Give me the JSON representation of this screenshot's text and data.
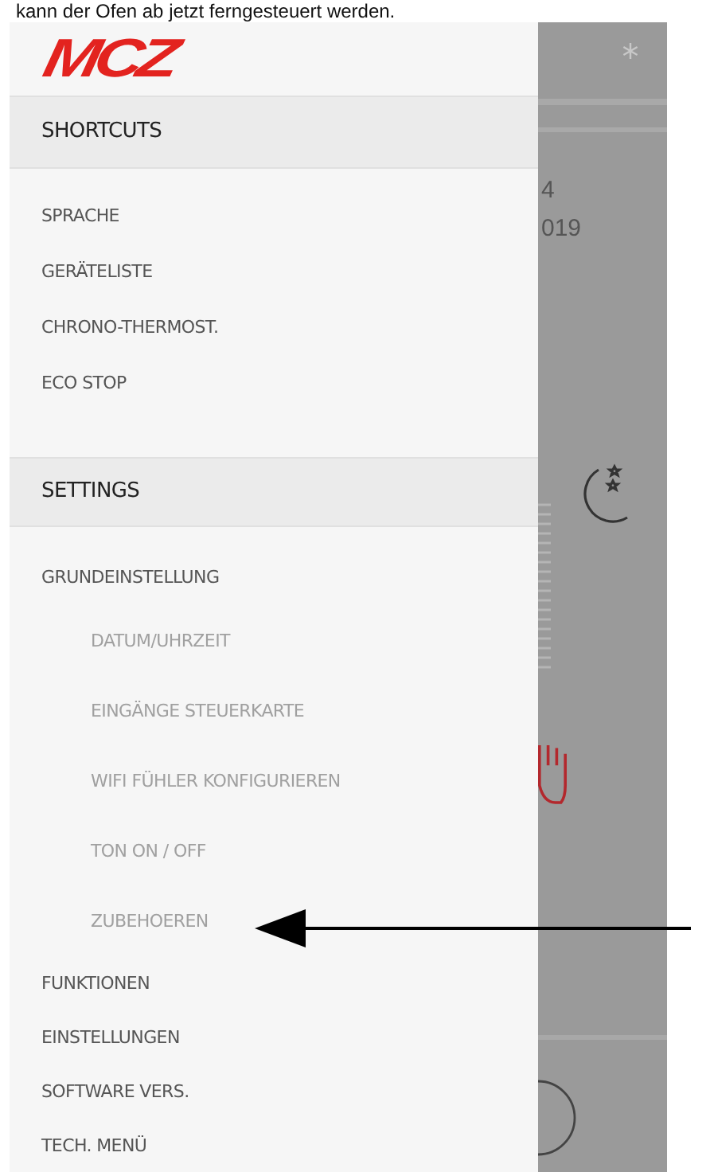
{
  "caption": "kann der Ofen ab jetzt ferngesteuert werden.",
  "logo": "MCZ",
  "shortcuts": {
    "header": "SHORTCUTS",
    "items": [
      {
        "label": "SPRACHE"
      },
      {
        "label": "GERÄTELISTE"
      },
      {
        "label": "CHRONO-THERMOST."
      },
      {
        "label": "ECO STOP"
      }
    ]
  },
  "settings": {
    "header": "SETTINGS",
    "items": [
      {
        "label": "GRUNDEINSTELLUNG",
        "children": [
          {
            "label": "DATUM/UHRZEIT"
          },
          {
            "label": "EINGÄNGE STEUERKARTE"
          },
          {
            "label": "WIFI FÜHLER KONFIGURIEREN"
          },
          {
            "label": "TON ON / OFF"
          },
          {
            "label": "ZUBEHOEREN"
          }
        ]
      },
      {
        "label": "FUNKTIONEN"
      },
      {
        "label": "EINSTELLUNGEN"
      },
      {
        "label": "SOFTWARE VERS."
      },
      {
        "label": "TECH. MENÜ"
      }
    ]
  },
  "background_texts": [
    "4",
    "019"
  ]
}
